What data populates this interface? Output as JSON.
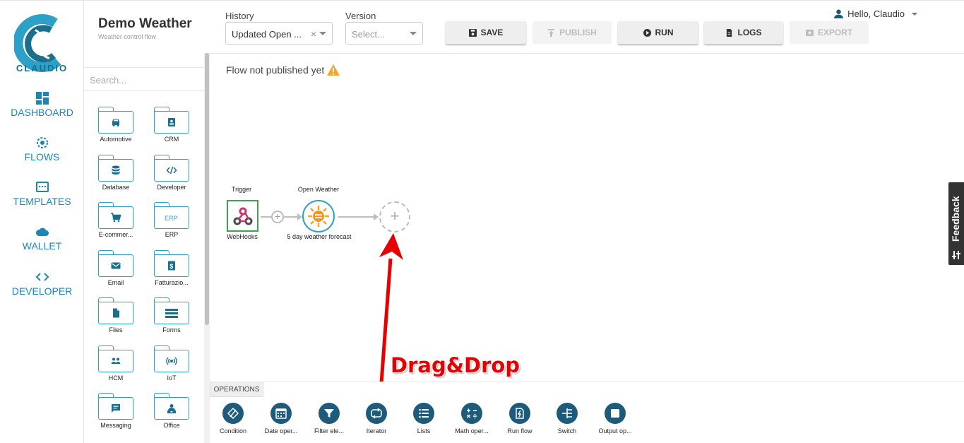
{
  "brand": {
    "logo_text": "CLAUDIO",
    "accent": "#1b86b8"
  },
  "nav": [
    {
      "id": "dashboard",
      "label": "DASHBOARD",
      "icon": "dashboard-icon"
    },
    {
      "id": "flows",
      "label": "FLOWS",
      "icon": "flows-icon"
    },
    {
      "id": "templates",
      "label": "TEMPLATES",
      "icon": "templates-icon"
    },
    {
      "id": "wallet",
      "label": "WALLET",
      "icon": "cloud-icon"
    },
    {
      "id": "developer",
      "label": "DEVELOPER",
      "icon": "code-icon"
    }
  ],
  "header": {
    "title": "Demo Weather",
    "subtitle": "Weather control flow",
    "history_label": "History",
    "history_value": "Updated Open ...",
    "version_label": "Version",
    "version_placeholder": "Select...",
    "user": "Hello, Claudio"
  },
  "toolbar": {
    "save": "SAVE",
    "publish": "PUBLISH",
    "run": "RUN",
    "logs": "LOGS",
    "export": "EXPORT"
  },
  "panel": {
    "search_placeholder": "Search...",
    "categories": [
      {
        "name": "Automotive",
        "icon": "car-icon"
      },
      {
        "name": "CRM",
        "icon": "contact-card-icon"
      },
      {
        "name": "Database",
        "icon": "database-icon"
      },
      {
        "name": "Developer",
        "icon": "code-icon"
      },
      {
        "name": "E-commer...",
        "icon": "cart-icon"
      },
      {
        "name": "ERP",
        "icon": "erp-icon"
      },
      {
        "name": "Email",
        "icon": "email-icon"
      },
      {
        "name": "Fatturazio...",
        "icon": "invoice-icon"
      },
      {
        "name": "Files",
        "icon": "file-icon"
      },
      {
        "name": "Forms",
        "icon": "form-icon"
      },
      {
        "name": "HCM",
        "icon": "people-icon"
      },
      {
        "name": "IoT",
        "icon": "iot-icon"
      },
      {
        "name": "Messaging",
        "icon": "message-icon"
      },
      {
        "name": "Office",
        "icon": "office-worker-icon"
      }
    ]
  },
  "canvas": {
    "notice": "Flow not published yet",
    "trigger": {
      "title": "Trigger",
      "name": "WebHooks"
    },
    "step": {
      "title": "Open Weather",
      "name": "5 day weather forecast"
    },
    "annotation": "Drag&Drop"
  },
  "operations": {
    "tab_label": "OPERATIONS",
    "items": [
      {
        "label": "Condition",
        "icon": "condition-icon"
      },
      {
        "label": "Date oper...",
        "icon": "calendar-icon"
      },
      {
        "label": "Filter ele...",
        "icon": "filter-icon"
      },
      {
        "label": "Iterator",
        "icon": "iterator-icon"
      },
      {
        "label": "Lists",
        "icon": "list-icon"
      },
      {
        "label": "Math oper...",
        "icon": "math-icon"
      },
      {
        "label": "Run flow",
        "icon": "run-flow-icon"
      },
      {
        "label": "Switch",
        "icon": "switch-icon"
      },
      {
        "label": "Output op...",
        "icon": "output-icon"
      }
    ]
  },
  "feedback_label": "Feedback"
}
